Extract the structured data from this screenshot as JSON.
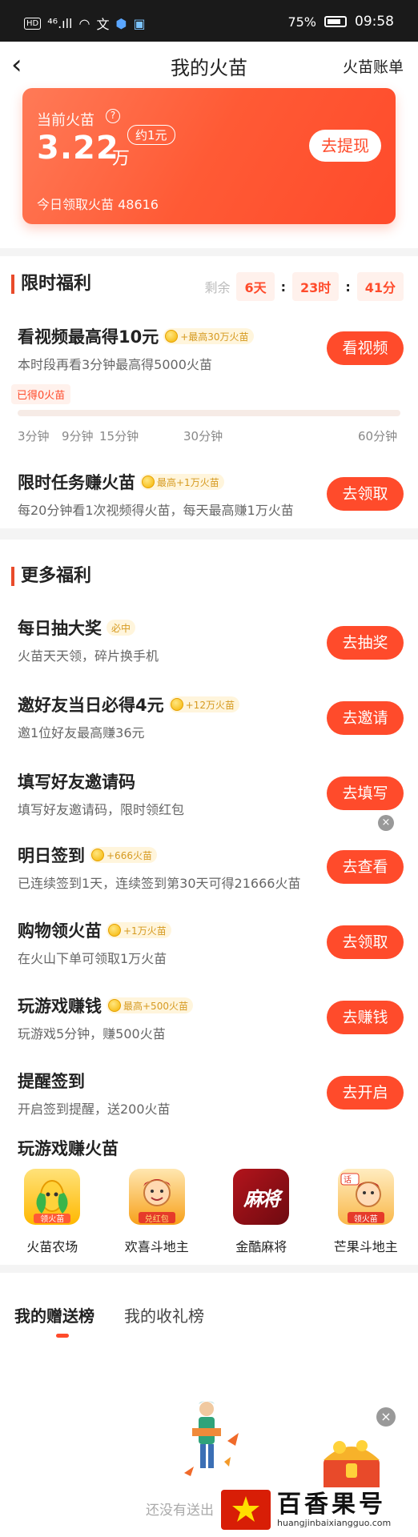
{
  "status_bar": {
    "left": "HD ⁴⁶.ıll",
    "battery": "75%",
    "time": "09:58"
  },
  "header": {
    "title": "我的火苗",
    "ledger": "火苗账单"
  },
  "balance_card": {
    "label": "当前火苗",
    "amount": "3.22",
    "unit": "万",
    "approx": "约1元",
    "withdraw": "去提现",
    "today": "今日领取火苗 48616"
  },
  "limited": {
    "title": "限时福利",
    "remaining": "剩余",
    "days": "6天",
    "hours": "23时",
    "minutes": "41分",
    "video": {
      "title": "看视频最高得10元",
      "badge": "+最高30万火苗",
      "desc": "本时段再看3分钟最高得5000火苗",
      "button": "看视频",
      "earned": "已得0火苗",
      "progress": 0,
      "ticks": [
        "3分钟",
        "9分钟",
        "15分钟",
        "30分钟",
        "60分钟"
      ]
    },
    "task": {
      "title": "限时任务赚火苗",
      "badge": "最高+1万火苗",
      "desc": "每20分钟看1次视频得火苗，每天最高赚1万火苗",
      "button": "去领取"
    }
  },
  "more": {
    "title": "更多福利",
    "items": [
      {
        "title": "每日抽大奖",
        "badge": "必中",
        "desc": "火苗天天领，碎片换手机",
        "button": "去抽奖"
      },
      {
        "title": "邀好友当日必得4元",
        "badge": "+12万火苗",
        "desc": "邀1位好友最高赚36元",
        "button": "去邀请"
      },
      {
        "title": "填写好友邀请码",
        "badge": "",
        "desc": "填写好友邀请码，限时领红包",
        "button": "去填写"
      },
      {
        "title": "明日签到",
        "badge": "+666火苗",
        "desc": "已连续签到1天，连续签到第30天可得21666火苗",
        "button": "去查看"
      },
      {
        "title": "购物领火苗",
        "badge": "+1万火苗",
        "desc": "在火山下单可领取1万火苗",
        "button": "去领取"
      },
      {
        "title": "玩游戏赚钱",
        "badge": "最高+500火苗",
        "desc": "玩游戏5分钟，赚500火苗",
        "button": "去赚钱"
      },
      {
        "title": "提醒签到",
        "badge": "",
        "desc": "开启签到提醒，送200火苗",
        "button": "去开启"
      }
    ],
    "games_title": "玩游戏赚火苗",
    "games": [
      {
        "name": "火苗农场",
        "tag": "领火苗"
      },
      {
        "name": "欢喜斗地主",
        "tag": "兑红包"
      },
      {
        "name": "金酷麻将",
        "tag": "麻将"
      },
      {
        "name": "芒果斗地主",
        "tag": "领火苗"
      }
    ]
  },
  "ranking": {
    "tab_active": "我的赠送榜",
    "tab_inactive": "我的收礼榜",
    "empty": "还没有送出"
  },
  "watermark": {
    "title": "百香果号",
    "url": "huangjinbaixiangguo.com"
  },
  "colors": {
    "accent": "#ff4b2b",
    "gold": "#f5b400"
  }
}
